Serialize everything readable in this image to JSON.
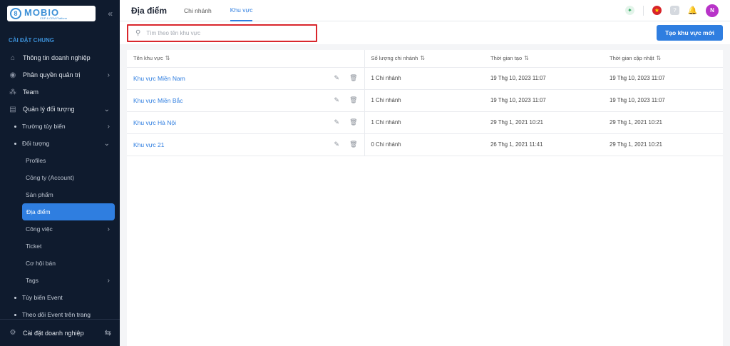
{
  "sidebar": {
    "logo_text": "MOBIO",
    "logo_sub": "CDP & CEM Platform",
    "logo_mark": "8",
    "section_title": "CÀI ĐẶT CHUNG",
    "items": [
      {
        "label": "Thông tin doanh nghiệp",
        "icon": "building-icon"
      },
      {
        "label": "Phân quyền quản trị",
        "icon": "user-shield-icon"
      },
      {
        "label": "Team",
        "icon": "team-icon"
      },
      {
        "label": "Quản lý đối tượng",
        "icon": "database-icon"
      }
    ],
    "sub_items": {
      "truong_tuy_bien": "Trường tùy biến",
      "doi_tuong": "Đối tượng",
      "tuy_bien_event": "Tùy biến Event",
      "theo_doi_event": "Theo dõi Event trên trang"
    },
    "objects": [
      "Profiles",
      "Công ty (Account)",
      "Sản phẩm",
      "Địa điểm",
      "Công việc",
      "Ticket",
      "Cơ hội bán",
      "Tags"
    ],
    "footer_label": "Cài đặt doanh nghiệp"
  },
  "topbar": {
    "title": "Địa điểm",
    "tabs": [
      "Chi nhánh",
      "Khu vực"
    ],
    "active_tab": "Khu vực",
    "avatar_initial": "N"
  },
  "search": {
    "placeholder": "Tìm theo tên khu vực"
  },
  "toolbar": {
    "create_label": "Tạo khu vực mới"
  },
  "table": {
    "headers": [
      "Tên khu vực",
      "Số lượng chi nhánh",
      "Thời gian tạo",
      "Thời gian cập nhật"
    ],
    "rows": [
      {
        "name": "Khu vực Miền Nam",
        "count": "1 Chi nhánh",
        "created": "19 Thg 10, 2023 11:07",
        "updated": "19 Thg 10, 2023 11:07"
      },
      {
        "name": "Khu vực Miền Bắc",
        "count": "1 Chi nhánh",
        "created": "19 Thg 10, 2023 11:07",
        "updated": "19 Thg 10, 2023 11:07"
      },
      {
        "name": "Khu vực Hà Nội",
        "count": "1 Chi nhánh",
        "created": "29 Thg 1, 2021 10:21",
        "updated": "29 Thg 1, 2021 10:21"
      },
      {
        "name": "Khu vực 21",
        "count": "0 Chi nhánh",
        "created": "26 Thg 1, 2021 11:41",
        "updated": "29 Thg 1, 2021 10:21"
      }
    ]
  },
  "colors": {
    "sidebar_bg": "#0f1b2e",
    "accent": "#2f7ee0",
    "highlight_border": "#d9262c"
  }
}
